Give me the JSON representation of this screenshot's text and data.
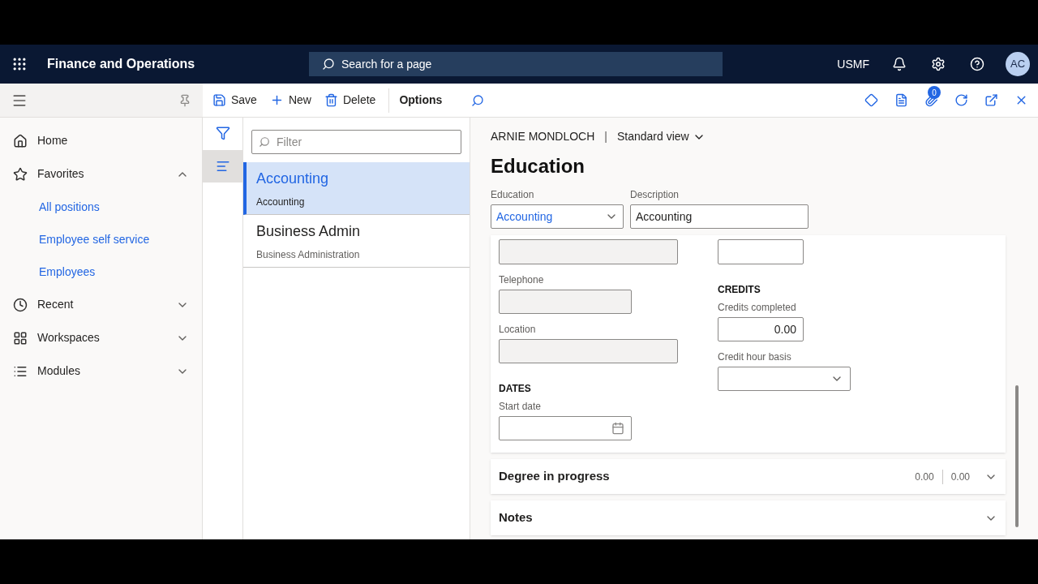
{
  "header": {
    "app_title": "Finance and Operations",
    "search_placeholder": "Search for a page",
    "company": "USMF",
    "avatar": "AC"
  },
  "toolbar": {
    "buttons": [
      {
        "kind": "save",
        "label": "Save"
      },
      {
        "kind": "new",
        "label": "New"
      },
      {
        "kind": "delete",
        "label": "Delete"
      },
      {
        "kind": "options",
        "label": "Options"
      }
    ],
    "attachments_count": "0"
  },
  "nav": {
    "items": [
      {
        "kind": "home",
        "label": "Home"
      },
      {
        "kind": "star",
        "label": "Favorites",
        "expanded": true,
        "children": [
          {
            "label": "All positions"
          },
          {
            "label": "Employee self service"
          },
          {
            "label": "Employees"
          }
        ]
      },
      {
        "kind": "clock",
        "label": "Recent",
        "expanded": false
      },
      {
        "kind": "workspace",
        "label": "Workspaces",
        "expanded": false
      },
      {
        "kind": "modules",
        "label": "Modules",
        "expanded": false
      }
    ]
  },
  "list": {
    "filter_placeholder": "Filter",
    "records": [
      {
        "title": "Accounting",
        "subtitle": "Accounting",
        "selected": true
      },
      {
        "title": "Business Admin",
        "subtitle": "Business Administration",
        "selected": false
      }
    ]
  },
  "detail": {
    "person": "ARNIE MONDLOCH",
    "separator": "|",
    "view": "Standard view",
    "title": "Education",
    "top_fields": [
      {
        "kind": "dropdown",
        "label": "Education",
        "value": "Accounting"
      },
      {
        "kind": "text",
        "label": "Description",
        "value": "Accounting"
      }
    ],
    "columns": [
      [
        {
          "kind": "partial",
          "disabled": true
        },
        {
          "kind": "text",
          "label": "Telephone",
          "disabled": true
        },
        {
          "kind": "text",
          "label": "Location",
          "disabled": true
        },
        {
          "kind": "heading",
          "label": "DATES"
        },
        {
          "kind": "date",
          "label": "Start date",
          "disabled": false
        }
      ],
      [
        {
          "kind": "partial",
          "disabled": false
        },
        {
          "kind": "heading",
          "label": "CREDITS"
        },
        {
          "kind": "number",
          "label": "Credits completed",
          "value": "0.00",
          "disabled": false
        },
        {
          "kind": "dropdown",
          "label": "Credit hour basis",
          "disabled": false
        }
      ]
    ],
    "fasttabs": [
      {
        "title": "Degree in progress",
        "summaries": [
          "0.00",
          "0.00"
        ],
        "expanded": false
      },
      {
        "title": "Notes",
        "expanded": false
      }
    ]
  }
}
